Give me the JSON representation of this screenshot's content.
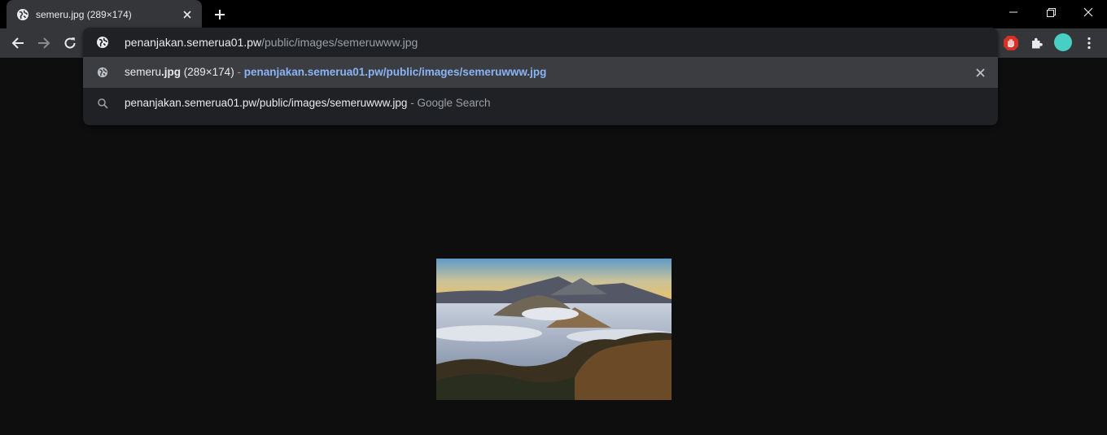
{
  "tab": {
    "title": "semeru.jpg (289×174)",
    "favicon": "globe-icon",
    "close_icon": "close-icon"
  },
  "new_tab_icon": "plus-icon",
  "window_controls": [
    "minimize-icon",
    "restore-icon",
    "close-icon"
  ],
  "toolbar": {
    "back_icon": "arrow-left-icon",
    "forward_icon": "arrow-right-icon",
    "reload_icon": "reload-icon",
    "extensions": [
      "stop-hand-extension-icon",
      "puzzle-icon"
    ],
    "menu_icon": "kebab-menu-icon",
    "avatar_color": "#48cfc4"
  },
  "omnibox": {
    "host": "penanjakan.semerua01.pw",
    "path": "/public/images/semeruwww.jpg",
    "suggestions": [
      {
        "icon": "globe-icon",
        "title_plain": "semeru",
        "title_bold": ".jpg",
        "title_rest": " (289×174)",
        "separator": " - ",
        "url": "penanjakan.semerua01.pw/public/images/semeruwww.jpg",
        "remove_icon": "close-icon"
      },
      {
        "icon": "search-icon",
        "text": "penanjakan.semerua01.pw/public/images/semeruwww.jpg",
        "separator": " - ",
        "provider": "Google Search"
      }
    ]
  },
  "image": {
    "name": "semeru.jpg",
    "width": 289,
    "height": 174
  },
  "colors": {
    "page_background": "#0e0e0e",
    "toolbar": "#35363a",
    "popup": "#202124",
    "selected_row": "#3c3d40",
    "link": "#8ab4f8"
  }
}
